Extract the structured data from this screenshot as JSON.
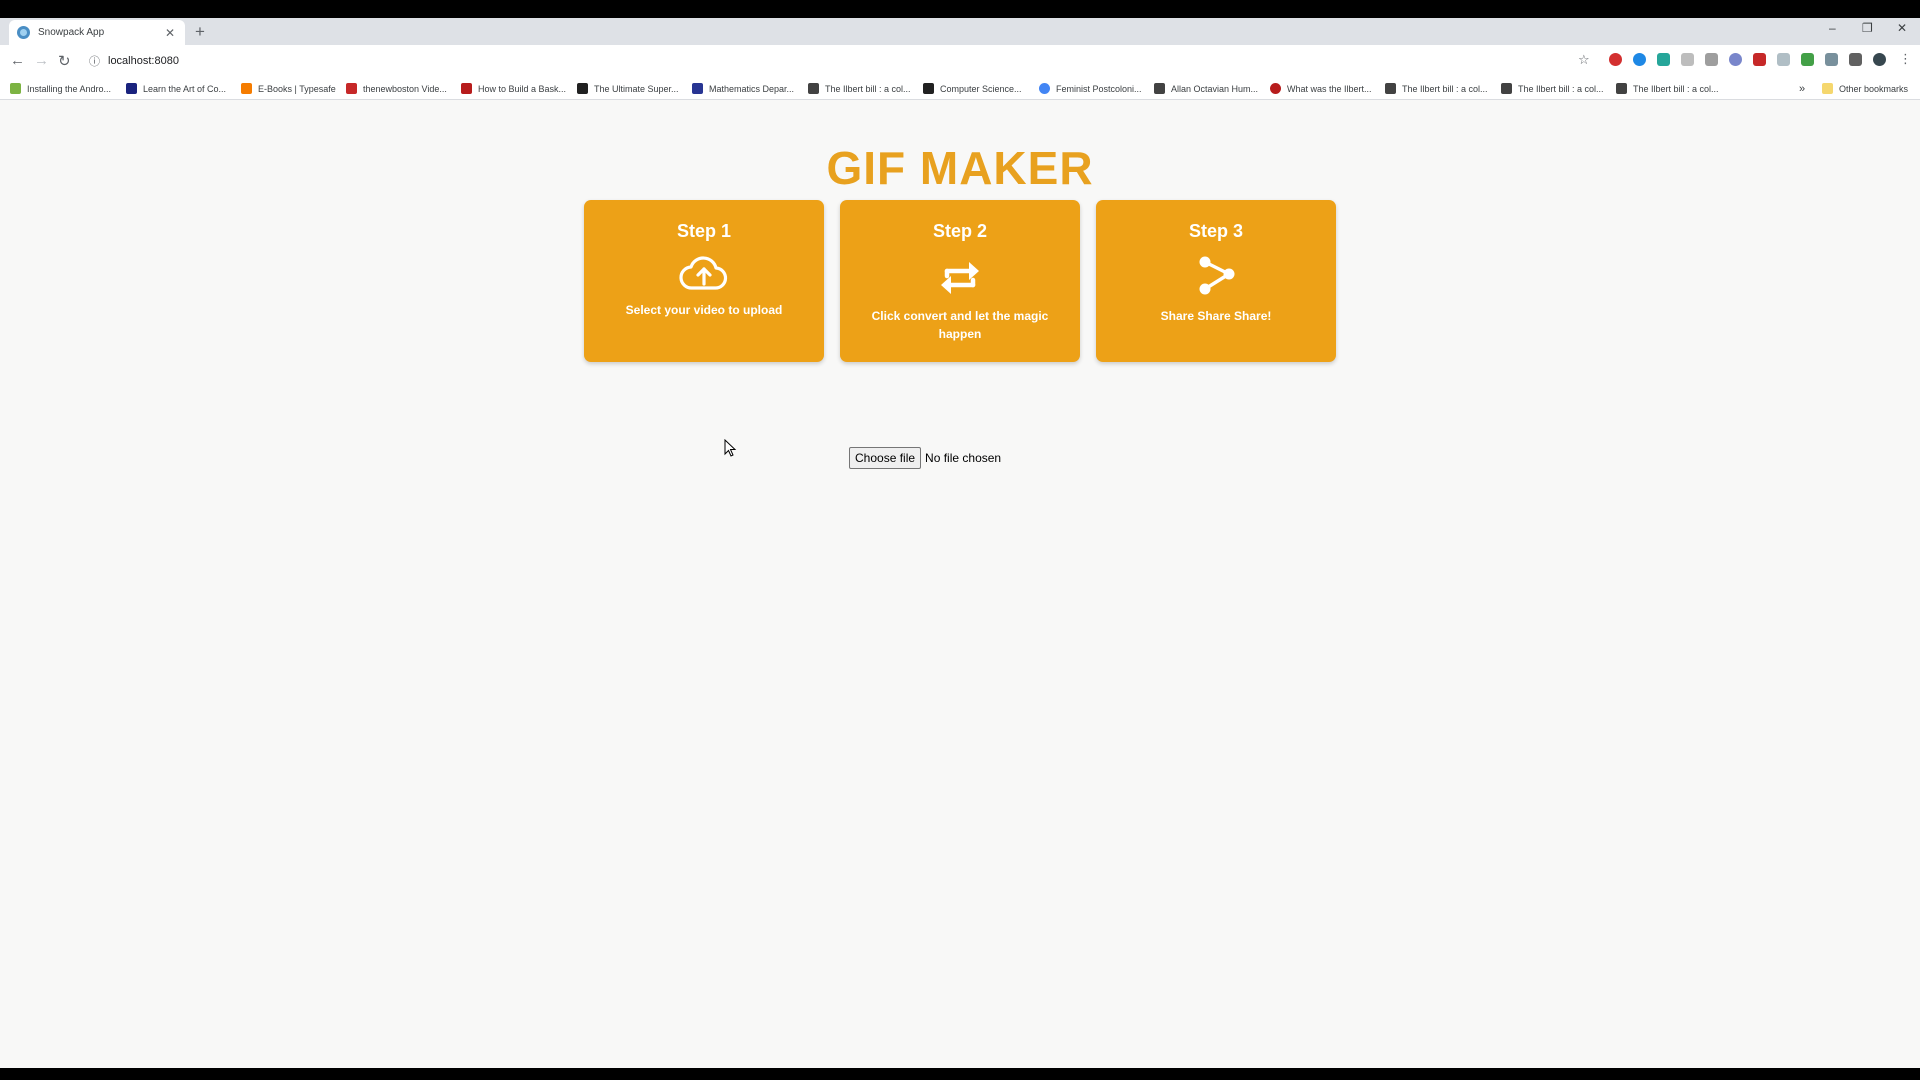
{
  "browser": {
    "tab": {
      "title": "Snowpack App"
    },
    "new_tab_label": "+",
    "window_controls": [
      "–",
      "❐",
      "✕"
    ],
    "address": "localhost:8080",
    "bookmarks": [
      {
        "label": "Installing the Andro...",
        "icon_color": "#7cb342"
      },
      {
        "label": "Learn the Art of Co...",
        "icon_color": "#1a237e"
      },
      {
        "label": "E-Books | Typesafe",
        "icon_color": "#f57c00"
      },
      {
        "label": "thenewboston Vide...",
        "icon_color": "#c62828"
      },
      {
        "label": "How to Build a Bask...",
        "icon_color": "#b71c1c"
      },
      {
        "label": "The Ultimate Super...",
        "icon_color": "#212121"
      },
      {
        "label": "Mathematics Depar...",
        "icon_color": "#283593"
      },
      {
        "label": "The Ilbert bill : a col...",
        "icon_color": "#424242"
      },
      {
        "label": "Computer Science...",
        "icon_color": "#212121"
      },
      {
        "label": "Feminist Postcoloni...",
        "icon_color": "#4285f4"
      },
      {
        "label": "Allan Octavian Hum...",
        "icon_color": "#424242"
      },
      {
        "label": "What was the Ilbert...",
        "icon_color": "#b71c1c"
      },
      {
        "label": "The Ilbert bill : a col...",
        "icon_color": "#424242"
      },
      {
        "label": "The Ilbert bill : a col...",
        "icon_color": "#424242"
      },
      {
        "label": "The Ilbert bill : a col...",
        "icon_color": "#424242"
      }
    ],
    "overflow_label": "»",
    "other_bookmarks": "Other bookmarks"
  },
  "page": {
    "title": "GIF MAKER",
    "accent_color": "#eda117",
    "steps": [
      {
        "title": "Step 1",
        "text": "Select your video to upload",
        "icon": "cloud-upload-icon"
      },
      {
        "title": "Step 2",
        "text": "Click convert and let the magic happen",
        "icon": "convert-arrows-icon"
      },
      {
        "title": "Step 3",
        "text": "Share Share Share!",
        "icon": "share-icon"
      }
    ],
    "file_input": {
      "button_label": "Choose file",
      "status": "No file chosen"
    }
  }
}
